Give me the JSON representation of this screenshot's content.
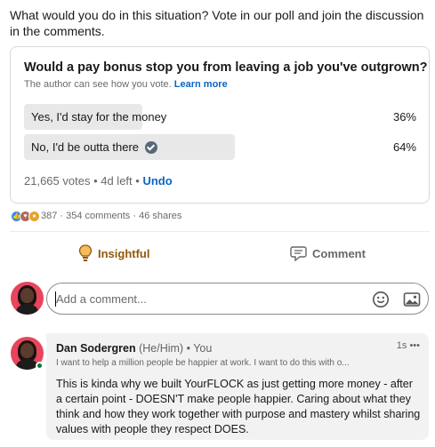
{
  "post": {
    "intro_text": "What would you do in this situation? Vote in our poll and join the discussion in the comments."
  },
  "poll": {
    "question": "Would a pay bonus stop you from leaving a job you've outgrown?",
    "note": "The author can see how you vote.",
    "learn_more": "Learn more",
    "options": [
      {
        "label": "Yes, I'd stay for the money",
        "percent_text": "36%",
        "percent": 36,
        "selected": false
      },
      {
        "label": "No, I'd be outta there",
        "percent_text": "64%",
        "percent": 64,
        "selected": true
      }
    ],
    "votes": "21,665 votes",
    "time_left": "4d left",
    "undo": "Undo"
  },
  "social": {
    "reaction_icons": [
      "like-icon",
      "love-icon",
      "insightful-icon"
    ],
    "reaction_count": "387",
    "comments": "354 comments",
    "shares": "46 shares"
  },
  "actions": {
    "insightful_label": "Insightful",
    "comment_label": "Comment"
  },
  "comment_input": {
    "placeholder": "Add a comment..."
  },
  "comment": {
    "author": "Dan Sodergren",
    "pronouns": "(He/Him)",
    "connection": "You",
    "headline": "I want to help a million people be happier at work. I want to do this with o...",
    "time": "1s",
    "more": "•••",
    "text": "This is kinda why we built YourFLOCK as just getting more money - after a certain point - DOESN'T make people happier. Caring about what they think and how they work together with purpose and mastery whilst sharing values with people they respect DOES."
  },
  "colors": {
    "link_blue": "#0a66c2",
    "insightful_brown": "#915907",
    "poll_bar": "#e8e8e8",
    "avatar_bg": "#e8455c",
    "online_green": "#057642"
  }
}
